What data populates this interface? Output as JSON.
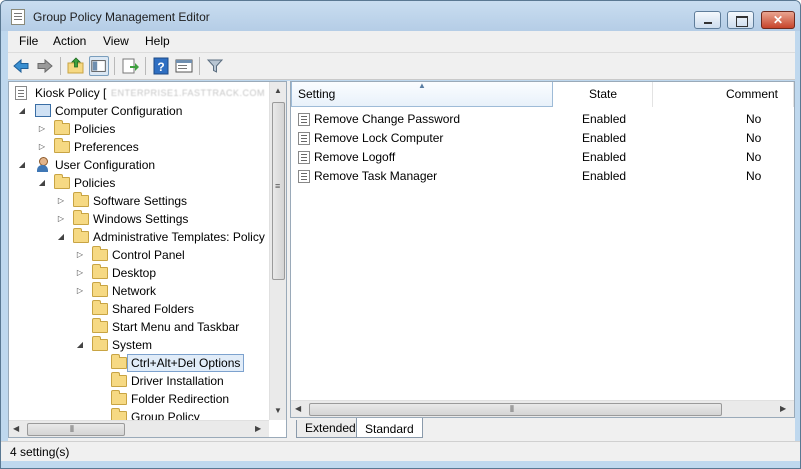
{
  "window": {
    "title": "Group Policy Management Editor",
    "close_glyph": "✕"
  },
  "menu": {
    "items": [
      "File",
      "Action",
      "View",
      "Help"
    ]
  },
  "toolbar": {
    "icons": [
      "back-arrow-icon",
      "forward-arrow-icon",
      "up-folder-icon",
      "show-hide-tree-icon",
      "export-list-icon",
      "help-icon",
      "properties-icon",
      "filter-icon"
    ]
  },
  "tree": {
    "root": {
      "label": "Kiosk Policy [",
      "obscured": "ENTERPRISE1.FASTTRACK.COM"
    },
    "items": [
      {
        "label": "Computer Configuration",
        "icon": "computer-icon",
        "expanded": true
      },
      {
        "label": "Policies",
        "icon": "folder-icon",
        "expanded": false
      },
      {
        "label": "Preferences",
        "icon": "folder-icon",
        "expanded": false
      },
      {
        "label": "User Configuration",
        "icon": "user-icon",
        "expanded": true
      },
      {
        "label": "Policies",
        "icon": "folder-icon",
        "expanded": true
      },
      {
        "label": "Software Settings",
        "icon": "folder-icon",
        "expanded": false
      },
      {
        "label": "Windows Settings",
        "icon": "folder-icon",
        "expanded": false
      },
      {
        "label": "Administrative Templates: Policy",
        "icon": "folder-icon",
        "expanded": true
      },
      {
        "label": "Control Panel",
        "icon": "folder-icon",
        "expanded": false
      },
      {
        "label": "Desktop",
        "icon": "folder-icon",
        "expanded": false
      },
      {
        "label": "Network",
        "icon": "folder-icon",
        "expanded": false
      },
      {
        "label": "Shared Folders",
        "icon": "folder-icon",
        "expanded": false
      },
      {
        "label": "Start Menu and Taskbar",
        "icon": "folder-icon",
        "expanded": false
      },
      {
        "label": "System",
        "icon": "folder-icon",
        "expanded": true
      },
      {
        "label": "Ctrl+Alt+Del Options",
        "icon": "folder-icon",
        "selected": true
      },
      {
        "label": "Driver Installation",
        "icon": "folder-icon"
      },
      {
        "label": "Folder Redirection",
        "icon": "folder-icon"
      },
      {
        "label": "Group Policy",
        "icon": "folder-icon"
      }
    ]
  },
  "list": {
    "columns": [
      "Setting",
      "State",
      "Comment"
    ],
    "sorted_column": "Setting",
    "rows": [
      {
        "setting": "Remove Change Password",
        "state": "Enabled",
        "comment": "No"
      },
      {
        "setting": "Remove Lock Computer",
        "state": "Enabled",
        "comment": "No"
      },
      {
        "setting": "Remove Logoff",
        "state": "Enabled",
        "comment": "No"
      },
      {
        "setting": "Remove Task Manager",
        "state": "Enabled",
        "comment": "No"
      }
    ]
  },
  "tabs": {
    "items": [
      "Extended",
      "Standard"
    ],
    "active": "Standard"
  },
  "status": {
    "text": "4 setting(s)"
  },
  "colors": {
    "title_bar": "#bfd8ee",
    "selection": "#e1ecf8",
    "close_button": "#c7442b"
  }
}
